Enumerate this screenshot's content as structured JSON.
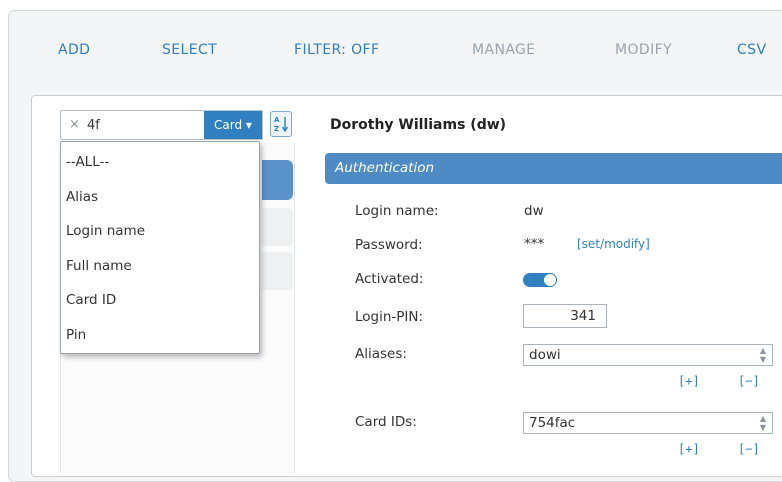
{
  "nav": {
    "items": [
      {
        "label": "ADD",
        "enabled": true
      },
      {
        "label": "SELECT",
        "enabled": true
      },
      {
        "label": "FILTER: OFF",
        "enabled": true
      },
      {
        "label": "MANAGE",
        "enabled": false
      },
      {
        "label": "MODIFY",
        "enabled": false
      },
      {
        "label": "CSV",
        "enabled": true
      }
    ]
  },
  "search": {
    "clear_symbol": "×",
    "value": "4f",
    "field_selector": "Card ▾"
  },
  "dropdown": {
    "options": [
      "--ALL--",
      "Alias",
      "Login name",
      "Full name",
      "Card ID",
      "Pin"
    ]
  },
  "user": {
    "title": "Dorothy Williams (dw)"
  },
  "section": {
    "title": "Authentication"
  },
  "fields": {
    "login_name_label": "Login name:",
    "login_name_value": "dw",
    "password_label": "Password:",
    "password_value": "***",
    "password_link": "[set/modify]",
    "activated_label": "Activated:",
    "activated": true,
    "login_pin_label": "Login-PIN:",
    "login_pin_value": "341",
    "aliases_label": "Aliases:",
    "aliases_value": "dowi",
    "card_ids_label": "Card IDs:",
    "card_ids_value": "754fac",
    "add_label": "[+]",
    "remove_label": "[−]"
  },
  "icons": {
    "sort": "sort-az-icon",
    "clear": "close-icon",
    "spinner": "spinner-arrows-icon"
  },
  "colors": {
    "accent": "#2f7fc1",
    "section_bar": "#4e8ac4",
    "disabled_nav": "#9aa3ab"
  }
}
